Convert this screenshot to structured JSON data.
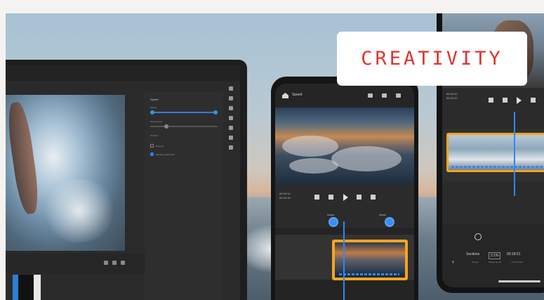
{
  "badge": {
    "label": "CREATIVITY",
    "color": "#e2332b"
  },
  "laptop": {
    "panel_title": "Speed",
    "rows": [
      "Speed",
      "Ramp speed",
      "Duration",
      "Reverse",
      "Maintain Audio Pitch"
    ],
    "accent": "#2f7fe0"
  },
  "phone_left": {
    "title": "Speed",
    "timecode": [
      "00:20:14",
      "00:24:10"
    ],
    "accent_clip": "#f5a51f",
    "playhead_color": "#2f88ff"
  },
  "phone_right": {
    "timecode": [
      "00:18:10",
      "00:22:10"
    ],
    "segments": [
      {
        "label": "Sections",
        "sub": "Range"
      },
      {
        "label": "2:1%",
        "sub": "Range Speed"
      },
      {
        "label": "00:18:21",
        "sub": "Clip Duration"
      }
    ]
  }
}
